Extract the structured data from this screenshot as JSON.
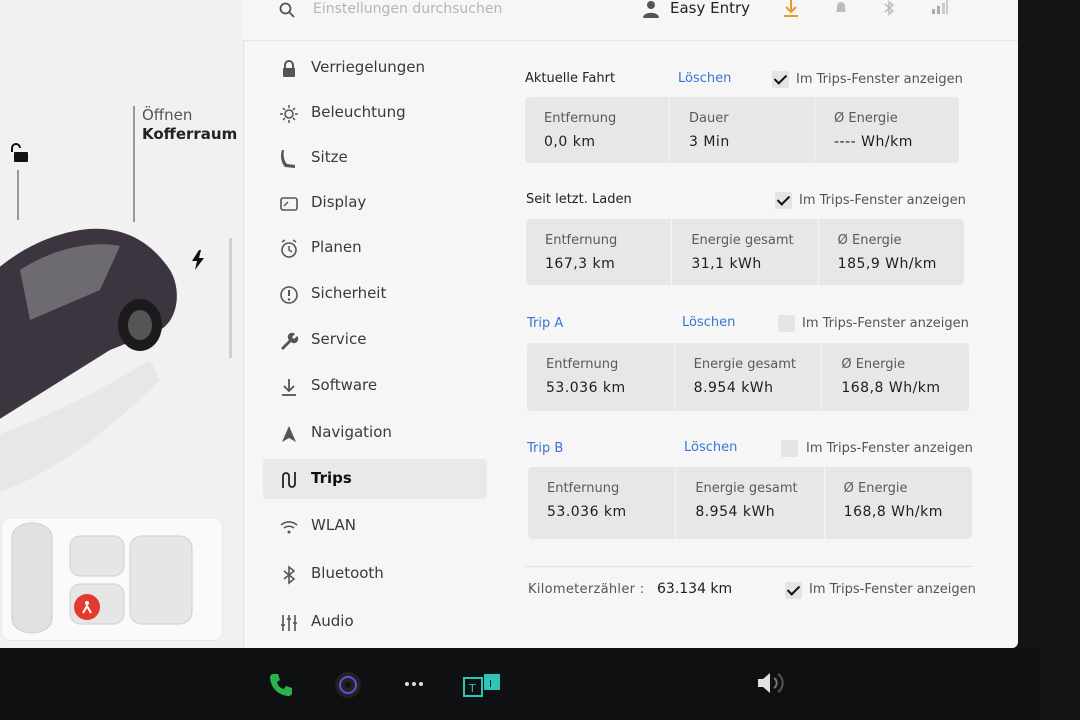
{
  "topbar": {
    "search_placeholder": "Einstellungen durchsuchen",
    "profile_name": "Easy Entry"
  },
  "car": {
    "trunk_label_1": "Öffnen",
    "trunk_label_2": "Kofferraum"
  },
  "menu": {
    "items": [
      {
        "label": "Verriegelungen",
        "icon": "lock-icon"
      },
      {
        "label": "Beleuchtung",
        "icon": "sun-icon"
      },
      {
        "label": "Sitze",
        "icon": "seat-icon"
      },
      {
        "label": "Display",
        "icon": "display-icon"
      },
      {
        "label": "Planen",
        "icon": "clock-icon"
      },
      {
        "label": "Sicherheit",
        "icon": "alert-circle-icon"
      },
      {
        "label": "Service",
        "icon": "wrench-icon"
      },
      {
        "label": "Software",
        "icon": "download-icon"
      },
      {
        "label": "Navigation",
        "icon": "navigation-arrow-icon"
      },
      {
        "label": "Trips",
        "icon": "trip-route-icon",
        "active": true
      },
      {
        "label": "WLAN",
        "icon": "wifi-icon"
      },
      {
        "label": "Bluetooth",
        "icon": "bluetooth-icon"
      },
      {
        "label": "Audio",
        "icon": "equalizer-icon"
      }
    ]
  },
  "trips": {
    "show_label": "Im Trips-Fenster anzeigen",
    "clear_label": "Löschen",
    "current": {
      "title": "Aktuelle Fahrt",
      "checked": true,
      "stats": [
        {
          "label": "Entfernung",
          "value": "0,0 km"
        },
        {
          "label": "Dauer",
          "value": "3 Min"
        },
        {
          "label": "Ø Energie",
          "value": "---- Wh/km"
        }
      ]
    },
    "since_charge": {
      "title": "Seit letzt. Laden",
      "checked": true,
      "stats": [
        {
          "label": "Entfernung",
          "value": "167,3 km"
        },
        {
          "label": "Energie gesamt",
          "value": "31,1 kWh"
        },
        {
          "label": "Ø Energie",
          "value": "185,9 Wh/km"
        }
      ]
    },
    "trip_a": {
      "title": "Trip A",
      "checked": false,
      "stats": [
        {
          "label": "Entfernung",
          "value": "53.036 km"
        },
        {
          "label": "Energie gesamt",
          "value": "8.954 kWh"
        },
        {
          "label": "Ø Energie",
          "value": "168,8 Wh/km"
        }
      ]
    },
    "trip_b": {
      "title": "Trip B",
      "checked": false,
      "stats": [
        {
          "label": "Entfernung",
          "value": "53.036 km"
        },
        {
          "label": "Energie gesamt",
          "value": "8.954 kWh"
        },
        {
          "label": "Ø Energie",
          "value": "168,8 Wh/km"
        }
      ]
    },
    "odometer": {
      "label": "Kilometerzähler :",
      "value": "63.134 km",
      "checked": true
    }
  },
  "colors": {
    "accent_blue": "#3a74d4",
    "download_orange": "#e89a2c",
    "phone_green": "#2bb34a",
    "alert_red": "#e23a2e"
  }
}
